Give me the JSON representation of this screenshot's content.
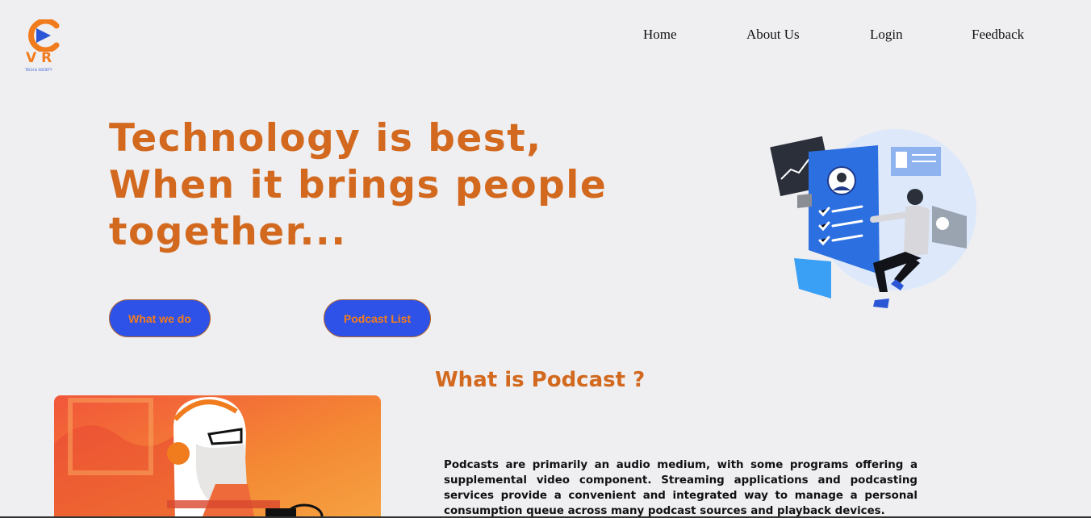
{
  "logo": {
    "letters": "VR",
    "tagline": "TECH & SOCIETY",
    "accent": "#f07c1e",
    "play_color": "#2b56d6",
    "icon": "play-icon"
  },
  "nav": {
    "items": [
      {
        "label": "Home"
      },
      {
        "label": "About Us"
      },
      {
        "label": "Login"
      },
      {
        "label": "Feedback"
      }
    ]
  },
  "hero": {
    "lines": [
      "Technology is best,",
      "When it brings people",
      "together..."
    ],
    "color": "#d2691e"
  },
  "buttons": {
    "what_we_do": "What we do",
    "podcast_list": "Podcast List",
    "bg": "#2e52e8",
    "text_color": "#f07c1e"
  },
  "section": {
    "title": "What is Podcast ?",
    "body": "Podcasts are primarily an audio medium, with some programs offering a supplemental video component. Streaming applications and podcasting services provide a convenient and integrated way to manage a personal consumption queue across many podcast sources and playback devices."
  }
}
